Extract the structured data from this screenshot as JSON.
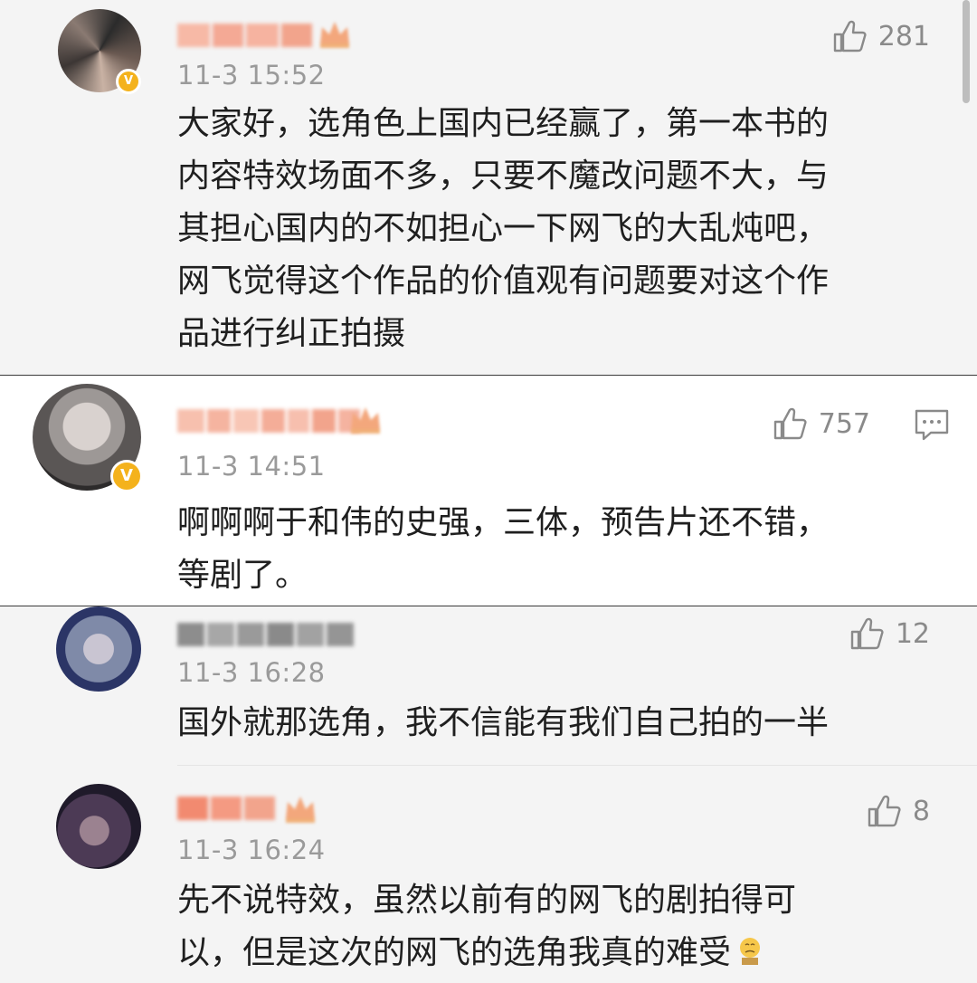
{
  "comments": [
    {
      "time": "11-3 15:52",
      "likes": "281",
      "text": "大家好，选角色上国内已经赢了，第一本书的\n内容特效场面不多，只要不魔改问题不大，与\n其担心国内的不如担心一下网飞的大乱炖吧，\n网飞觉得这个作品的价值观有问题要对这个作\n品进行纠正拍摄",
      "verified": true,
      "has_crown": true
    },
    {
      "time": "11-3 14:51",
      "likes": "757",
      "text": "啊啊啊于和伟的史强，三体，预告片还不错，\n等剧了。",
      "verified": true,
      "has_crown": true,
      "has_reply_icon": true
    },
    {
      "time": "11-3 16:28",
      "likes": "12",
      "text": "国外就那选角，我不信能有我们自己拍的一半",
      "verified": false,
      "has_crown": false
    },
    {
      "time": "11-3 16:24",
      "likes": "8",
      "text": "先不说特效，虽然以前有的网飞的剧拍得可\n以，但是这次的网飞的选角我真的难受",
      "verified": false,
      "has_crown": true,
      "trailing_emoji": "emoji-sad-face"
    }
  ],
  "icons": {
    "like": "thumbs-up-icon",
    "reply": "comment-bubble-icon",
    "verified": "verified-v-badge-icon",
    "crown": "crown-member-icon"
  },
  "verified_letter": "V",
  "colors": {
    "badge": "#f4b21c",
    "muted_text": "#9a9a9a",
    "body_text": "#1f1f1f",
    "username_blur": "#f2a48c"
  }
}
